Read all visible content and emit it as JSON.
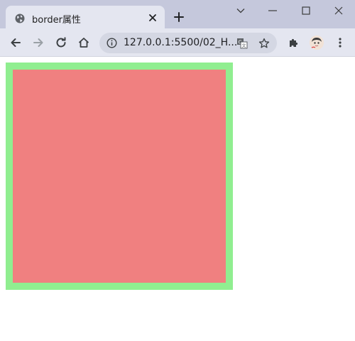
{
  "browser": {
    "tab": {
      "title": "border属性",
      "favicon": "globe-icon",
      "close_icon": "close-icon"
    },
    "new_tab_icon": "plus-icon",
    "window_controls": [
      "chevron-down-icon",
      "minimize-icon",
      "maximize-icon",
      "close-icon"
    ],
    "toolbar": {
      "back_icon": "arrow-left-icon",
      "forward_icon": "arrow-right-icon",
      "reload_icon": "reload-icon",
      "home_icon": "home-icon",
      "url": "127.0.0.1:5500/02_H...",
      "translate_icon": "translate-icon",
      "bookmark_icon": "star-icon",
      "extensions_icon": "puzzle-icon",
      "avatar": "avatar",
      "menu_icon": "kebab-menu-icon"
    },
    "colors": {
      "tabstrip": "#c5c8dc",
      "toolbar": "#e4e6f0",
      "omnibox": "#d4d7e3"
    }
  },
  "page": {
    "box": {
      "background": "#f08080",
      "border_color": "#90ee90"
    }
  }
}
